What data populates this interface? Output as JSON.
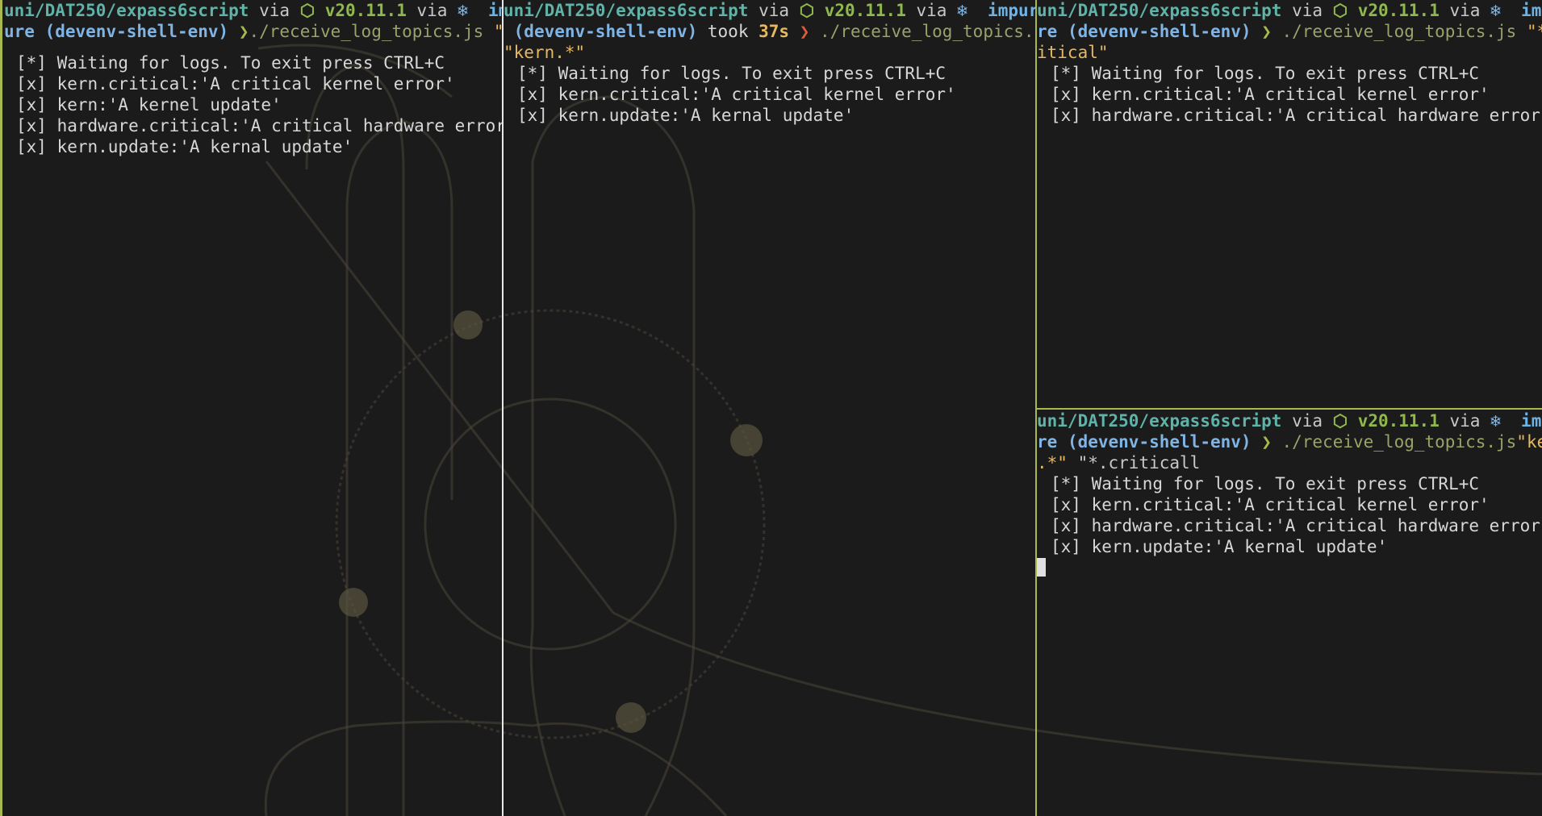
{
  "colors": {
    "background": "#1b1b1b",
    "path": "#5fb3a8",
    "node_version": "#8fb84d",
    "env": "#7fb4e4",
    "command": "#98a36a",
    "argument": "#e6b862",
    "error_arrow": "#e05a3a",
    "active_border": "#a9b94d"
  },
  "icons": {
    "node": "nodejs-hexagon-icon",
    "nix": "snowflake-icon"
  },
  "prompt": {
    "path": "uni/DAT250/expass6script",
    "via": "via",
    "node_version": "v20.11.1",
    "nix_glyph": "❄",
    "node_glyph": "⬡",
    "env": "(devenv-shell-env)",
    "arrow": "❯"
  },
  "panes": [
    {
      "impure_frag": "imp",
      "line2_start": "ure",
      "command": "./receive_log_topics.js",
      "args_inline": " \"#\"",
      "output": [
        "[*] Waiting for logs. To exit press CTRL+C",
        "[x] kern.critical:'A critical kernel error'",
        "[x] kern:'A kernel update'",
        "[x] hardware.critical:'A critical hardware error'",
        "[x] kern.update:'A kernal update'"
      ]
    },
    {
      "impure_frag": "impurt",
      "took": "took",
      "duration": "37s",
      "command": "./receive_log_topics.js",
      "args_wrap": "\"kern.*\"",
      "output": [
        "[*] Waiting for logs. To exit press CTRL+C",
        "[x] kern.critical:'A critical kernel error'",
        "[x] kern.update:'A kernal update'"
      ]
    },
    {
      "impure_frag": "imp",
      "line2_start": "re",
      "command": "./receive_log_topics.js",
      "args_inline": " \"*.cr",
      "args_wrap": "itical\"",
      "output": [
        "[*] Waiting for logs. To exit press CTRL+C",
        "[x] kern.critical:'A critical kernel error'",
        "[x] hardware.critical:'A critical hardware error'"
      ]
    },
    {
      "impure_frag": "imp",
      "line2_start": "re",
      "command": "./receive_log_topics.js",
      "args_inline": "\"kern",
      "args_wrap_a": ".*\"",
      "args_wrap_b": " \"*.criticall",
      "output": [
        "[*] Waiting for logs. To exit press CTRL+C",
        "[x] kern.critical:'A critical kernel error'",
        "[x] hardware.critical:'A critical hardware error'",
        "[x] kern.update:'A kernal update'"
      ]
    }
  ]
}
